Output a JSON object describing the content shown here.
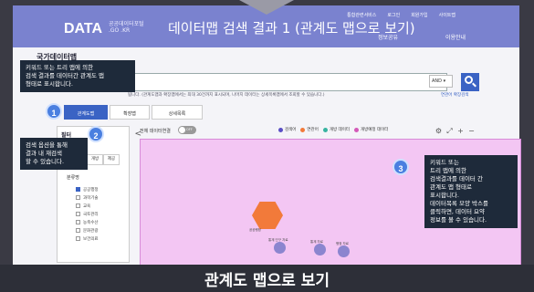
{
  "header": {
    "logo": "DATA",
    "logo_sub": "공공데이터포털 .GO .KR",
    "title": "데이터맵 검색 결과 1 (관계도 맵으로 보기)",
    "top_links": [
      "통합관련서비스",
      "로그인",
      "회원가입",
      "사이트맵"
    ],
    "menu_right": [
      "정보공유",
      "이용안내"
    ]
  },
  "db_title": "국가데이터맵",
  "search": {
    "operator": "AND",
    "info": "됩니다. (관계도맵과 확장맵에서는 최대 30건까지 표시되며, 나머지 데이터는 상세목록맵에서 조회할 수 있습니다.)",
    "link": "연관어 확장검색"
  },
  "view_tabs": [
    "관계도맵",
    "확장맵",
    "상세목록"
  ],
  "tooltips": {
    "t1": "키워드 또는 트리 맵에 의한\n검색 결과를 데이터간 관계도 맵\n형태로 표시합니다.",
    "t2": "검색 옵션을 통해\n결과 내 재검색\n할 수 있습니다.",
    "t3": "키워드 또는\n트리 맵에 의한\n검색결과를 데이터 간\n관계도 맵 형태로\n표시합니다.\n데이터목록 모양 박스를\n클릭하면, 데이터 요약\n정보를 볼 수 있습니다."
  },
  "badges": [
    "1",
    "2",
    "3"
  ],
  "filter": {
    "title": "필터",
    "collapse": "<",
    "tabs": [
      "개방",
      "제공"
    ],
    "group": "분류명",
    "items": [
      {
        "label": "공공행정",
        "checked": true
      },
      {
        "label": "과학기술",
        "checked": false
      },
      {
        "label": "교육",
        "checked": false
      },
      {
        "label": "국토관리",
        "checked": false
      },
      {
        "label": "농축수산",
        "checked": false
      },
      {
        "label": "문화관광",
        "checked": false
      },
      {
        "label": "보건의료",
        "checked": false
      }
    ]
  },
  "controls": {
    "toggle_label": "전체 데이터연결",
    "toggle_state": "OFF",
    "legend": [
      {
        "label": "검색어",
        "color": "#5a4fc4"
      },
      {
        "label": "연관어",
        "color": "#f27a3a"
      },
      {
        "label": "개방 데이터",
        "color": "#37b3a0"
      },
      {
        "label": "개방예정 데이터",
        "color": "#d45ab8"
      }
    ],
    "tools": [
      "⚙",
      "⤢",
      "+",
      "−"
    ]
  },
  "graph": {
    "center_label": "공공행정",
    "nodes": [
      "통계 인구 자료",
      "통계 자료",
      "행정 자료"
    ]
  },
  "bottom_title": "관계도 맵으로 보기"
}
